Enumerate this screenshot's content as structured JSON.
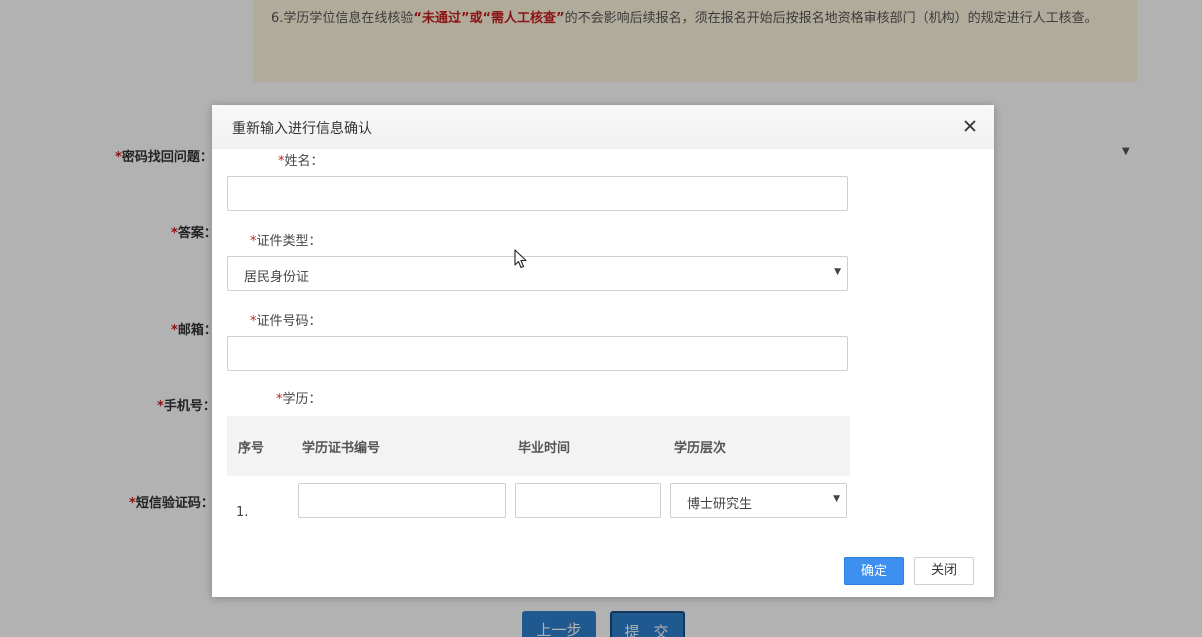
{
  "background": {
    "notice": {
      "prefix": "6.学历学位信息在线核验",
      "em1": "“未通过”",
      "mid": "或",
      "em2": "“需人工核查”",
      "suffix": "的不会影响后续报名，须在报名开始后按报名地资格审核部门（机构）的规定进行人工核查。"
    },
    "labels": {
      "security_question": "密码找回问题：",
      "answer": "答案：",
      "email": "邮箱：",
      "phone": "手机号：",
      "sms_code": "短信验证码："
    },
    "required_star": "*",
    "prev_button": "上一步",
    "submit_button": "提交"
  },
  "modal": {
    "title": "重新输入进行信息确认",
    "fields": {
      "name_label": "姓名：",
      "name_value": "",
      "id_type_label": "证件类型：",
      "id_type_value": "居民身份证",
      "id_number_label": "证件号码：",
      "id_number_value": "",
      "education_label": "学历："
    },
    "edu_table": {
      "headers": [
        "序号",
        "学历证书编号",
        "毕业时间",
        "学历层次"
      ],
      "rows": [
        {
          "index": "1.",
          "cert_no": "",
          "grad_date": "",
          "level": "博士研究生"
        }
      ]
    },
    "buttons": {
      "confirm": "确定",
      "close": "关闭"
    }
  },
  "colors": {
    "required": "#c81e1e",
    "primary": "#3d8ff0",
    "notice_bg": "#fdf5df",
    "overlay": "rgba(0,0,0,0.30)"
  },
  "icons": {
    "close": "close-icon",
    "dropdown": "chevron-down-icon",
    "cursor": "mouse-cursor-icon"
  }
}
